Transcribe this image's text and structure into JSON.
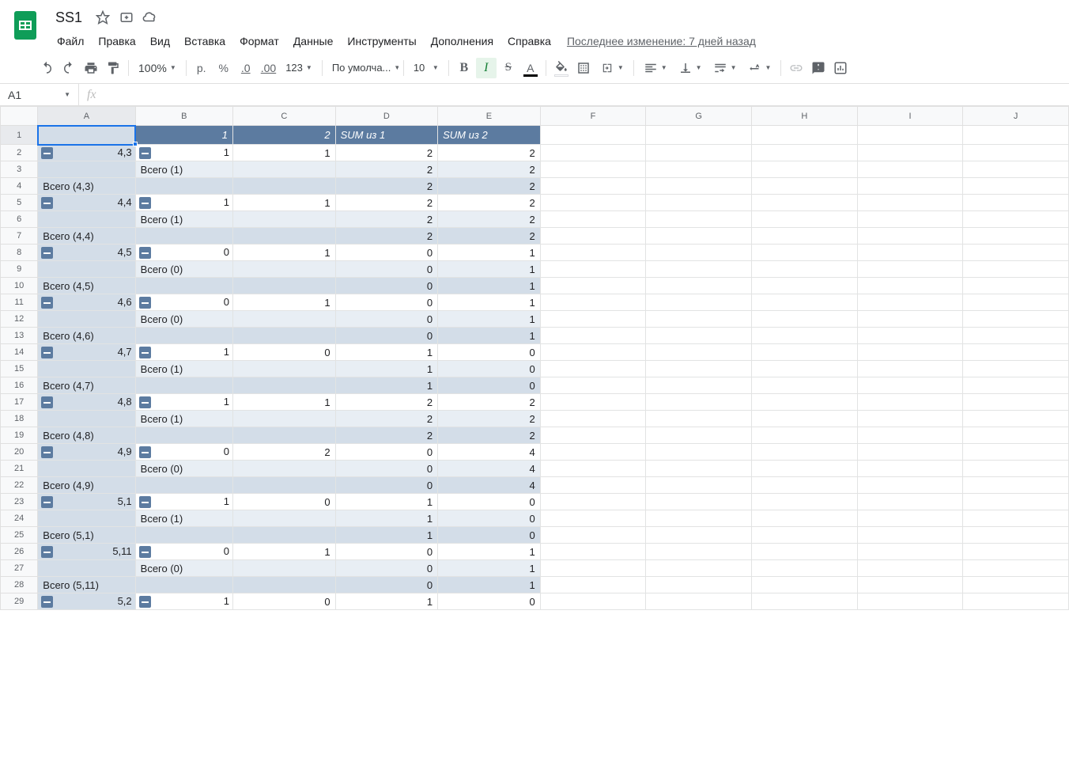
{
  "doc": {
    "title": "SS1"
  },
  "menus": [
    "Файл",
    "Правка",
    "Вид",
    "Вставка",
    "Формат",
    "Данные",
    "Инструменты",
    "Дополнения",
    "Справка"
  ],
  "last_edit": "Последнее изменение: 7 дней назад",
  "toolbar": {
    "zoom": "100%",
    "currency": "р.",
    "percent": "%",
    "dec_dec": ".0",
    "dec_inc": ".00",
    "more_fmt": "123",
    "font_family": "По умолча...",
    "font_size": "10",
    "bold": "B",
    "italic": "I",
    "strike": "S",
    "textcolor": "A"
  },
  "namebox": "A1",
  "formula": "",
  "columns": [
    "A",
    "B",
    "C",
    "D",
    "E",
    "F",
    "G",
    "H",
    "I",
    "J"
  ],
  "pivot_header": {
    "col_c": "1",
    "col_c2": "2",
    "sum1": "SUM из 1",
    "sum2": "SUM из 2"
  },
  "rows": [
    {
      "n": 2,
      "type": "data",
      "aBtn": true,
      "a": "4,3",
      "bBtn": true,
      "b": "1",
      "c": "1",
      "d": "2",
      "e": "2"
    },
    {
      "n": 3,
      "type": "sub",
      "b": "Всего (1)",
      "d": "2",
      "e": "2"
    },
    {
      "n": 4,
      "type": "tot",
      "a": "Всего (4,3)",
      "d": "2",
      "e": "2"
    },
    {
      "n": 5,
      "type": "data",
      "aBtn": true,
      "a": "4,4",
      "bBtn": true,
      "b": "1",
      "c": "1",
      "d": "2",
      "e": "2"
    },
    {
      "n": 6,
      "type": "sub",
      "b": "Всего (1)",
      "d": "2",
      "e": "2"
    },
    {
      "n": 7,
      "type": "tot",
      "a": "Всего (4,4)",
      "d": "2",
      "e": "2"
    },
    {
      "n": 8,
      "type": "data",
      "aBtn": true,
      "a": "4,5",
      "bBtn": true,
      "b": "0",
      "c": "1",
      "d": "0",
      "e": "1"
    },
    {
      "n": 9,
      "type": "sub",
      "b": "Всего (0)",
      "d": "0",
      "e": "1"
    },
    {
      "n": 10,
      "type": "tot",
      "a": "Всего (4,5)",
      "d": "0",
      "e": "1"
    },
    {
      "n": 11,
      "type": "data",
      "aBtn": true,
      "a": "4,6",
      "bBtn": true,
      "b": "0",
      "c": "1",
      "d": "0",
      "e": "1"
    },
    {
      "n": 12,
      "type": "sub",
      "b": "Всего (0)",
      "d": "0",
      "e": "1"
    },
    {
      "n": 13,
      "type": "tot",
      "a": "Всего (4,6)",
      "d": "0",
      "e": "1"
    },
    {
      "n": 14,
      "type": "data",
      "aBtn": true,
      "a": "4,7",
      "bBtn": true,
      "b": "1",
      "c": "0",
      "d": "1",
      "e": "0"
    },
    {
      "n": 15,
      "type": "sub",
      "b": "Всего (1)",
      "d": "1",
      "e": "0"
    },
    {
      "n": 16,
      "type": "tot",
      "a": "Всего (4,7)",
      "d": "1",
      "e": "0"
    },
    {
      "n": 17,
      "type": "data",
      "aBtn": true,
      "a": "4,8",
      "bBtn": true,
      "b": "1",
      "c": "1",
      "d": "2",
      "e": "2"
    },
    {
      "n": 18,
      "type": "sub",
      "b": "Всего (1)",
      "d": "2",
      "e": "2"
    },
    {
      "n": 19,
      "type": "tot",
      "a": "Всего (4,8)",
      "d": "2",
      "e": "2"
    },
    {
      "n": 20,
      "type": "data",
      "aBtn": true,
      "a": "4,9",
      "bBtn": true,
      "b": "0",
      "c": "2",
      "d": "0",
      "e": "4"
    },
    {
      "n": 21,
      "type": "sub",
      "b": "Всего (0)",
      "d": "0",
      "e": "4"
    },
    {
      "n": 22,
      "type": "tot",
      "a": "Всего (4,9)",
      "d": "0",
      "e": "4"
    },
    {
      "n": 23,
      "type": "data",
      "aBtn": true,
      "a": "5,1",
      "bBtn": true,
      "b": "1",
      "c": "0",
      "d": "1",
      "e": "0"
    },
    {
      "n": 24,
      "type": "sub",
      "b": "Всего (1)",
      "d": "1",
      "e": "0"
    },
    {
      "n": 25,
      "type": "tot",
      "a": "Всего (5,1)",
      "d": "1",
      "e": "0"
    },
    {
      "n": 26,
      "type": "data",
      "aBtn": true,
      "a": "5,11",
      "bBtn": true,
      "b": "0",
      "c": "1",
      "d": "0",
      "e": "1"
    },
    {
      "n": 27,
      "type": "sub",
      "b": "Всего (0)",
      "d": "0",
      "e": "1"
    },
    {
      "n": 28,
      "type": "tot",
      "a": "Всего (5,11)",
      "d": "0",
      "e": "1"
    },
    {
      "n": 29,
      "type": "data",
      "aBtn": true,
      "a": "5,2",
      "bBtn": true,
      "b": "1",
      "c": "0",
      "d": "1",
      "e": "0"
    }
  ]
}
